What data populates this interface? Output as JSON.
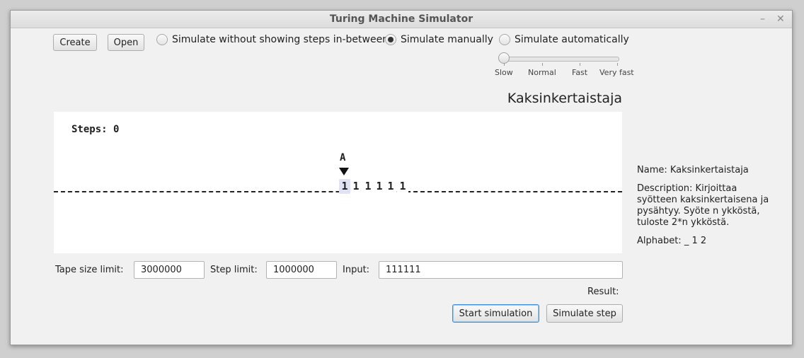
{
  "window": {
    "title": "Turing Machine Simulator",
    "minimize_label": "–",
    "close_label": "✕"
  },
  "toolbar": {
    "create_label": "Create",
    "open_label": "Open"
  },
  "modes": [
    {
      "label": "Simulate without showing steps in-between",
      "selected": false
    },
    {
      "label": "Simulate manually",
      "selected": true
    },
    {
      "label": "Simulate automatically",
      "selected": false
    }
  ],
  "speed": {
    "labels": [
      "Slow",
      "Normal",
      "Fast",
      "Very fast"
    ],
    "value": "Slow"
  },
  "machine_title": "Kaksinkertaistaja",
  "tape": {
    "steps_text": "Steps: 0",
    "head_state": "A",
    "cells": [
      "1",
      "1",
      "1",
      "1",
      "1",
      "1"
    ],
    "current_index": 0
  },
  "limits": {
    "tape_size_label": "Tape size limit:",
    "tape_size_value": "3000000",
    "step_limit_label": "Step limit:",
    "step_limit_value": "1000000",
    "input_label": "Input:",
    "input_value": "111111"
  },
  "result_label": "Result:",
  "actions": {
    "start_label": "Start simulation",
    "step_label": "Simulate step"
  },
  "info": {
    "name": "Name: Kaksinkertaistaja",
    "description": "Description: Kirjoittaa syötteen kaksinkertaisena ja pysähtyy. Syöte n ykköstä, tuloste 2*n ykköstä.",
    "alphabet": "Alphabet: _ 1 2"
  }
}
